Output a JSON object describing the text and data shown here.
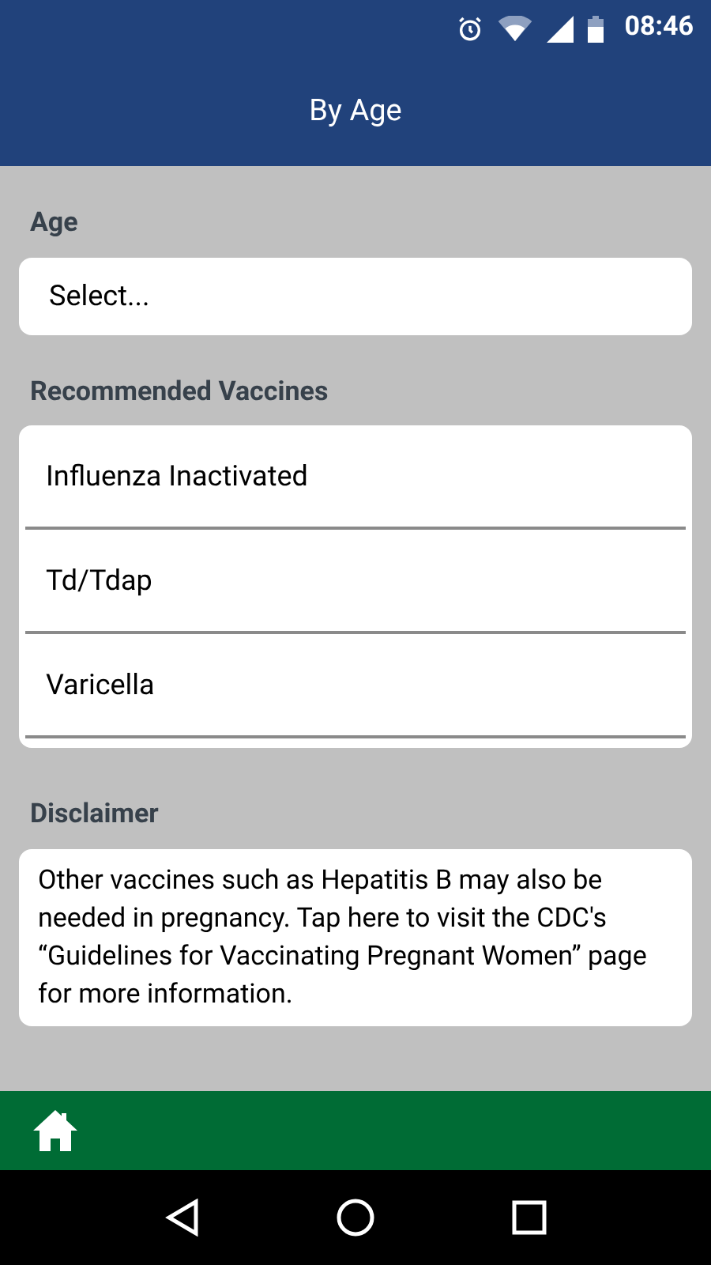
{
  "status_bar": {
    "time": "08:46"
  },
  "app_bar": {
    "title": "By Age"
  },
  "age": {
    "label": "Age",
    "placeholder": "Select..."
  },
  "recommended": {
    "label": "Recommended Vaccines",
    "items": [
      {
        "name": "Influenza Inactivated"
      },
      {
        "name": "Td/Tdap"
      },
      {
        "name": "Varicella"
      }
    ]
  },
  "disclaimer": {
    "label": "Disclaimer",
    "text": "Other vaccines such as Hepatitis B may also be needed in pregnancy. Tap here to visit the CDC's “Guidelines for Vaccinating Pregnant Women” page for more information."
  }
}
